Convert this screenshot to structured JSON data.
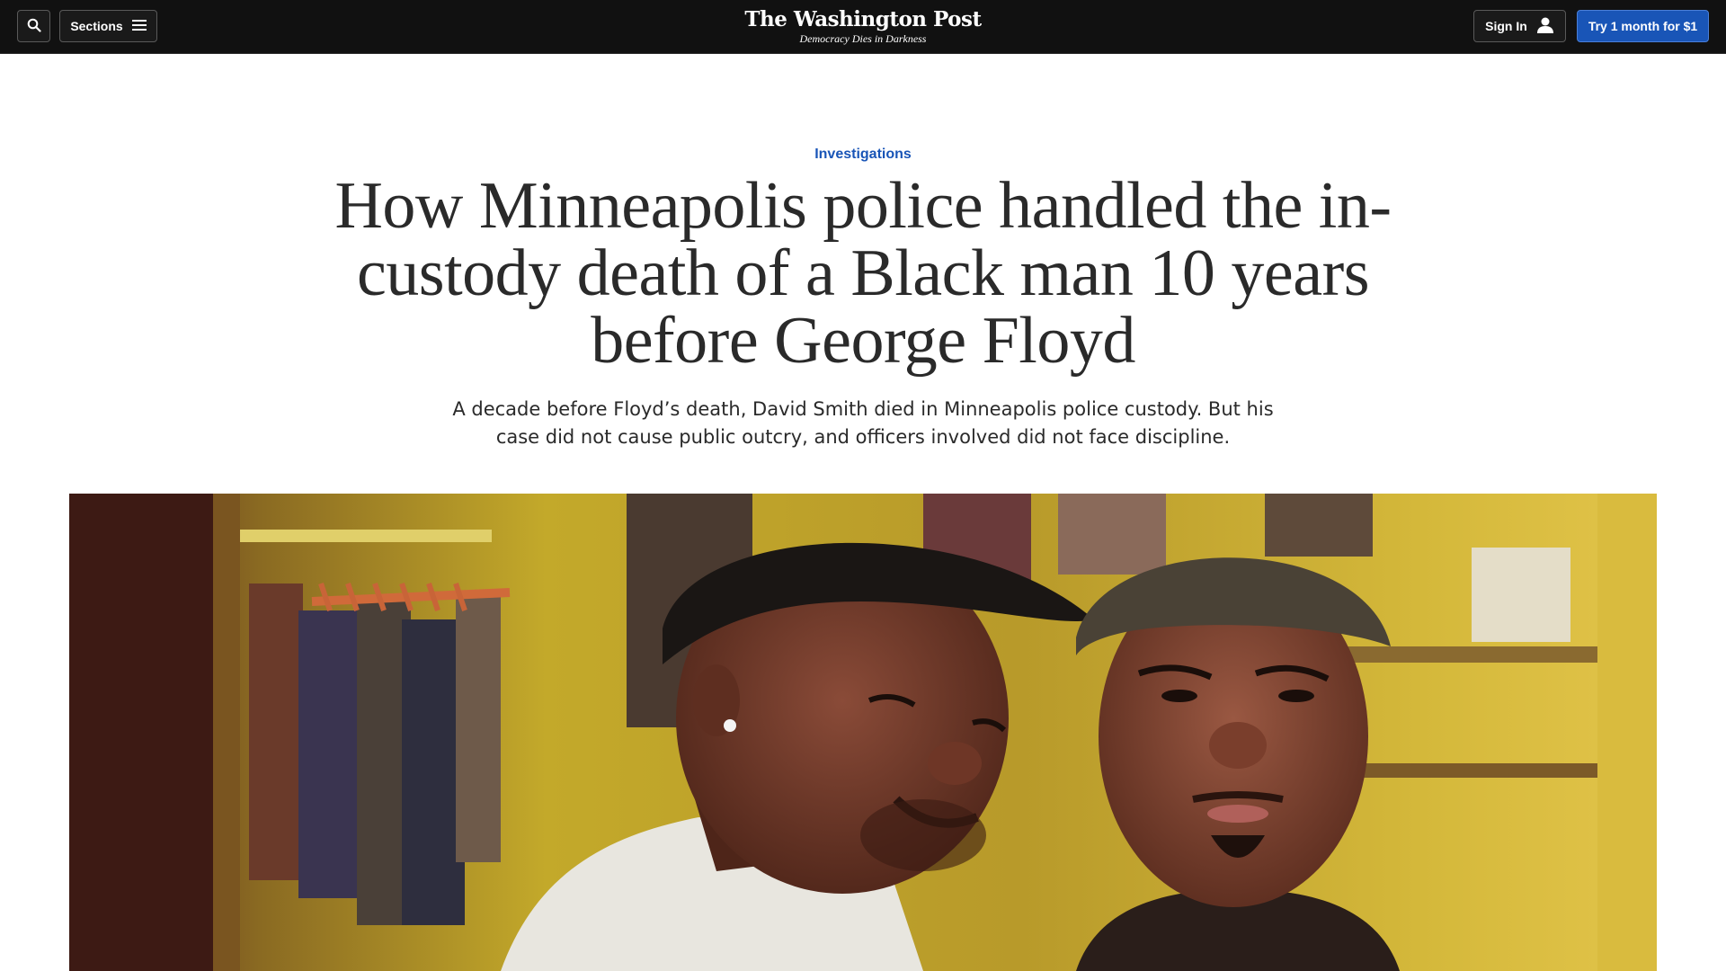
{
  "topbar": {
    "search_icon": "search-icon",
    "sections_label": "Sections",
    "sections_icon": "menu-icon",
    "masthead_title": "The Washington Post",
    "masthead_tagline": "Democracy Dies in Darkness",
    "signin_label": "Sign In",
    "signin_icon": "user-icon",
    "subscribe_label": "Try 1 month for $1",
    "colors": {
      "bar_bg": "#111111",
      "subscribe_bg": "#1955b7"
    }
  },
  "article": {
    "kicker": "Investigations",
    "headline": "How Minneapolis police handled the in-custody death of a Black man 10 years before George Floyd",
    "dek": "A decade before Floyd’s death, David Smith died in Minneapolis police custody. But his case did not cause public outcry, and officers involved did not face discipline.",
    "colors": {
      "kicker": "#1955b7",
      "text": "#2a2a2a"
    }
  },
  "lead_image": {
    "subject": "photo-two-men-in-closet"
  }
}
